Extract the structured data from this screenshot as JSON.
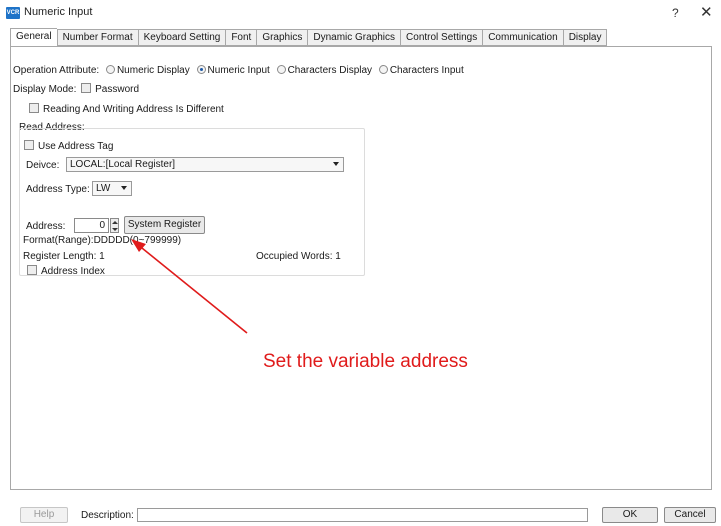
{
  "window": {
    "title": "Numeric Input",
    "icon_text": "VCR",
    "help_label": "?",
    "close_label": "✕"
  },
  "tabs": [
    "General",
    "Number Format",
    "Keyboard Setting",
    "Font",
    "Graphics",
    "Dynamic Graphics",
    "Control Settings",
    "Communication",
    "Display"
  ],
  "general": {
    "operation_attribute_label": "Operation Attribute:",
    "operation_options": [
      "Numeric Display",
      "Numeric Input",
      "Characters Display",
      "Characters Input"
    ],
    "operation_selected": "Numeric Input",
    "display_mode_label": "Display Mode:",
    "password_label": "Password",
    "rw_diff_label": "Reading And Writing Address Is Different",
    "read_address": {
      "group_label": "Read Address:",
      "use_tag_label": "Use Address Tag",
      "device_label": "Deivce:",
      "device_value": "LOCAL:[Local Register]",
      "address_type_label": "Address Type:",
      "address_type_value": "LW",
      "address_label": "Address:",
      "address_value": "0",
      "system_register_label": "System Register",
      "format_text": "Format(Range):DDDDD(0~799999)",
      "register_length_text": "Register Length: 1",
      "occupied_words_text": "Occupied Words: 1",
      "address_index_label": "Address Index"
    }
  },
  "annotation": {
    "text": "Set the variable address",
    "color": "#e01b1b"
  },
  "footer": {
    "help_label": "Help",
    "description_label": "Description:",
    "description_value": "",
    "ok_label": "OK",
    "cancel_label": "Cancel"
  }
}
